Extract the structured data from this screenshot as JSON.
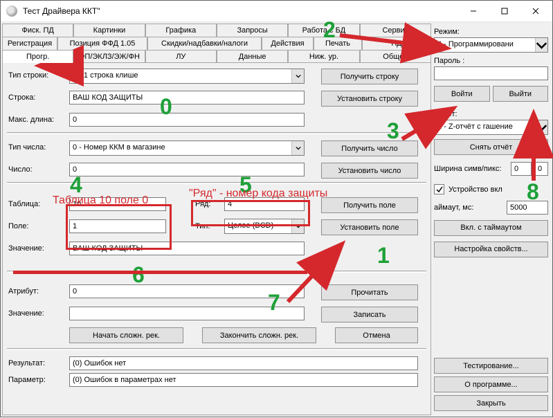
{
  "window": {
    "title": "Тест Драйвера ККТ\""
  },
  "tabs_row1": [
    "Фиск. ПД",
    "Картинки",
    "Графика",
    "Запросы",
    "Работа с БД",
    "Сервис"
  ],
  "tabs_row2": [
    "Регистрация",
    "Позиция ФФД 1.05",
    "Скидки/надбавки/налоги",
    "Действия",
    "Печать",
    "ПД"
  ],
  "tabs_row3": [
    "Прогр.",
    "ФП/ЭКЛЗ/ЭЖ/ФН",
    "ЛУ",
    "Данные",
    "Ниж. ур.",
    "Общее"
  ],
  "labels": {
    "tip_stroki": "Тип строки:",
    "stroka": "Строка:",
    "maks_dlina": "Макс. длина:",
    "tip_chisla": "Тип числа:",
    "chislo": "Число:",
    "tablitsa": "Таблица:",
    "ryad": "Ряд:",
    "pole": "Поле:",
    "tip": "Тип:",
    "znachenie1": "Значение:",
    "atribut": "Атрибут:",
    "znachenie2": "Значение:",
    "rezultat": "Результат:",
    "parametr": "Параметр:"
  },
  "fields": {
    "tip_stroki": "0 - 1 строка клише",
    "stroka": "ВАШ КОД ЗАЩИТЫ",
    "maks_dlina": "0",
    "tip_chisla": "0 - Номер ККМ в магазине",
    "chislo": "0",
    "tablitsa": "10",
    "ryad": "4",
    "pole": "1",
    "tip": "Целое (BCD)",
    "znachenie1": "ВАШ КОД ЗАЩИТЫ",
    "atribut": "0",
    "znachenie2": "",
    "rezultat": "(0) Ошибок нет",
    "parametr": "(0) Ошибок в параметрах нет"
  },
  "buttons": {
    "poluchit_stroku": "Получить строку",
    "ustanovit_stroku": "Установить строку",
    "poluchit_chislo": "Получить число",
    "ustanovit_chislo": "Установить число",
    "poluchit_pole": "Получить поле",
    "ustanovit_pole": "Установить поле",
    "prochitat": "Прочитать",
    "zapisat": "Записать",
    "nachat": "Начать сложн. рек.",
    "zakonchit": "Закончить сложн. рек.",
    "otmena": "Отмена"
  },
  "right": {
    "rezhim_label": "Режим:",
    "rezhim_value": "4 - Программировани",
    "parol_label": "Пароль :",
    "parol_value": "",
    "voiti": "Войти",
    "vyiti": "Выйти",
    "otchet_label": "Отчёт:",
    "otchet_value": "1 - Z-отчёт с гашение",
    "snyat_otchet": "Снять отчёт",
    "shirina_label": "Ширина симв/пикс:",
    "shirina_v1": "0",
    "shirina_v2": "0",
    "device_on": "Устройство вкл",
    "device_checked": true,
    "timeout_label": "аймаут, мс:",
    "timeout_value": "5000",
    "vkl_timeout": "Вкл. с таймаутом",
    "nastroika": "Настройка свойств...",
    "testirovanie": "Тестирование...",
    "o_programme": "О программе...",
    "zakryt": "Закрыть"
  },
  "annotations": {
    "n0": "0",
    "n1": "1",
    "n2": "2",
    "n3": "3",
    "n4": "4",
    "n5": "5",
    "n6": "6",
    "n7": "7",
    "n8": "8",
    "t_table": "Таблица 10 поле 0",
    "t_ryad": "\"Ряд\" - номер кода защиты"
  }
}
